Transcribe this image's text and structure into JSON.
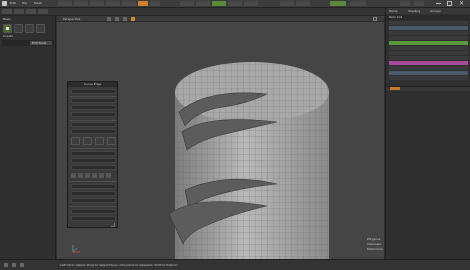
{
  "topbar": {
    "items": [
      "Edit",
      "File",
      "Mesh"
    ]
  },
  "left_panel": {
    "tab_label": "Basic",
    "sub_label": "Create",
    "section_button": "Edit Tools"
  },
  "viewport": {
    "header_label": "Perspective",
    "corner_info": [
      "Polygons",
      "Channels",
      "Deformers"
    ]
  },
  "flyout": {
    "title": "Curve Edge"
  },
  "right_panel": {
    "tabs": [
      "Items",
      "Shading",
      "Groups"
    ],
    "item_list_header": "Item List"
  },
  "status_bar": {
    "text": "Left Click: Select, Drag to Select Faces, Ctrl+Click to Deselect, Shift to Extend"
  }
}
